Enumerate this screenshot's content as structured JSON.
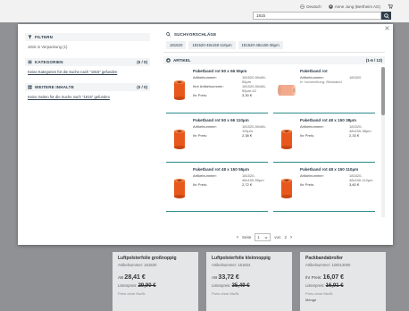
{
  "topbar": {
    "language": "Deutsch",
    "user": "Anne Jung (Bertheim AG)",
    "search_value": "1815"
  },
  "modal": {
    "filters": {
      "title": "FILTERN",
      "item": "1815 in Verpackung (1)"
    },
    "categories": {
      "title": "KATEGORIEN",
      "count": "(0 / 0)",
      "empty": "Keine Kategorien für die Suche nach \"1815\" gefunden"
    },
    "more": {
      "title": "WEITERE INHALTE",
      "count": "(0 / 0)",
      "empty": "Keine Seiten für die Suche nach \"1815\" gefunden"
    },
    "suggestions": {
      "title": "SUCHVORSCHLÄGE",
      "items": [
        "181520",
        "181520-48x150-110µm",
        "181520-48x150-38µm"
      ]
    },
    "articles": {
      "title": "ARTIKEL",
      "count": "(1-6 / 13)",
      "cards": [
        {
          "name": "Paketband rot 50 x 66 55µm",
          "k1": "Artikelnummer:",
          "v1": "181520-50x66-55µm",
          "k2": "Ihre Artikelnummer:",
          "v2": "181520-50x66-55µm-42",
          "k3": "Ihr Preis:",
          "v3": "3,30 €"
        },
        {
          "name": "Paketband rot",
          "k1": "Artikelnummer:",
          "v1": "181520",
          "note": "In Vorbereitung: Bleistaket"
        },
        {
          "name": "Paketband rot 50 x 66 110µm",
          "k1": "Artikelnummer:",
          "v1": "181520-50x66-110µm",
          "k3": "Ihr Preis:",
          "v3": "2,38 €"
        },
        {
          "name": "Paketband rot 48 x 150 38µm",
          "k1": "Artikelnummer:",
          "v1": "181520-48x150-38µm",
          "k3": "Ihr Preis:",
          "v3": "2,33 €"
        },
        {
          "name": "Paketband rot 48 x 150 55µm",
          "k1": "Artikelnummer:",
          "v1": "181520-48x150-55µm",
          "k3": "Ihr Preis:",
          "v3": "2,72 €"
        },
        {
          "name": "Paketband rot 48 x 150 110µm",
          "k1": "Artikelnummer:",
          "v1": "181520-48x150-110µm",
          "k3": "Ihr Preis:",
          "v3": "3,60 €"
        }
      ]
    },
    "pager": {
      "label": "Seite",
      "current": "1",
      "of": "von",
      "total": "2"
    }
  },
  "background_products": [
    {
      "name": "Luftpolsterfolie großnoppig",
      "art": "Artikelnummer: 151820",
      "from": "AB",
      "price": "28,41 €",
      "list_label": "Listenpreis:",
      "list": "29,90 €",
      "vat": "Preis ohne MwSt."
    },
    {
      "name": "Luftpolsterfolie kleinnoppig",
      "art": "Artikelnummer: 151824",
      "from": "AB",
      "price": "33,72 €",
      "list_label": "Listenpreis:",
      "list": "35,49 €",
      "vat": "Preis ohne MwSt."
    },
    {
      "name": "Packbandabroller",
      "art": "Artikelnummer: 120012000",
      "from": "Ihr Preis:",
      "price": "16,07 €",
      "list_label": "Listenpreis:",
      "list": "16,91 €",
      "vat": "Preis ohne MwSt.",
      "extra": "Menge"
    }
  ]
}
